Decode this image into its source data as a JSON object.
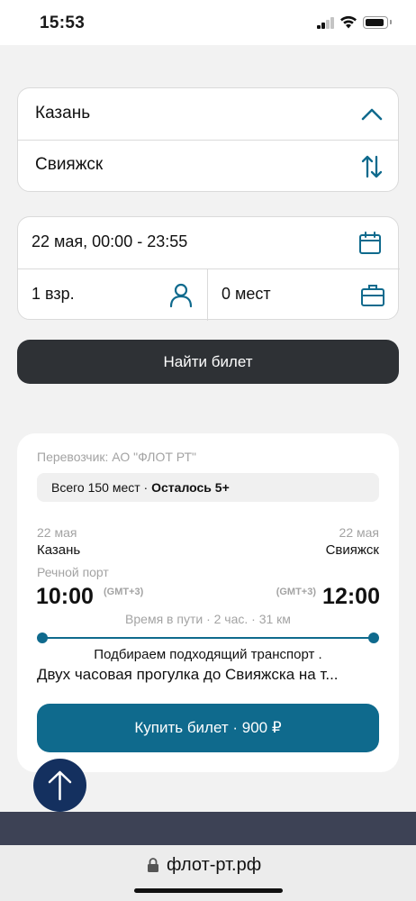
{
  "status_bar": {
    "time": "15:53"
  },
  "search": {
    "from": "Казань",
    "to": "Свияжск",
    "date_range": "22 мая, 00:00 - 23:55",
    "passengers": "1 взр.",
    "luggage": "0 мест",
    "find_label": "Найти билет"
  },
  "ticket": {
    "carrier": "Перевозчик: АО \"ФЛОТ РТ\"",
    "seats_total": "Всего 150 мест · ",
    "seats_left": "Осталось 5+",
    "departure": {
      "date": "22 мая",
      "city": "Казань",
      "port": "Речной порт",
      "time": "10:00",
      "tz": "(GMT+3)"
    },
    "arrival": {
      "date": "22 мая",
      "city": "Свияжск",
      "time": "12:00",
      "tz": "(GMT+3)"
    },
    "duration": "Время в пути · 2 час. · 31 км",
    "status": "Подбираем подходящий транспорт .",
    "description": "Двух часовая прогулка до Свияжска на т...",
    "buy_label": "Купить билет · 900 ₽"
  },
  "browser": {
    "url": "флот-рт.рф"
  },
  "colors": {
    "accent": "#0f6a8d",
    "dark_button": "#2e3135",
    "scroll_button": "#14305f"
  }
}
